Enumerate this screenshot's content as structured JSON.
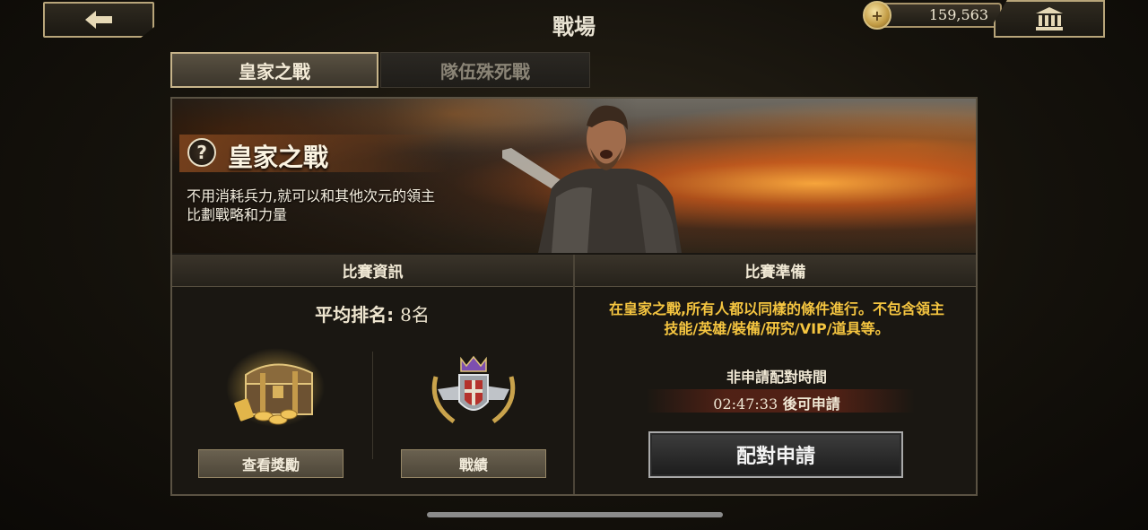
{
  "header": {
    "title": "戰場",
    "coins": "159,563",
    "back_icon": "back-arrow-icon",
    "bank_icon": "bank-icon",
    "coin_plus_icon": "coin-plus-icon"
  },
  "tabs": [
    {
      "label": "皇家之戰",
      "active": true
    },
    {
      "label": "隊伍殊死戰",
      "active": false
    }
  ],
  "banner": {
    "title": "皇家之戰",
    "description_line1": "不用消耗兵力,就可以和其他次元的領主",
    "description_line2": "比劃戰略和力量"
  },
  "info_section": {
    "header": "比賽資訊",
    "avg_rank_label": "平均排名:",
    "avg_rank_value": "8名",
    "rewards_button": "查看獎勵",
    "record_button": "戰績"
  },
  "prep_section": {
    "header": "比賽準備",
    "rules_line1": "在皇家之戰,所有人都以同樣的條件進行。不包含領主",
    "rules_line2": "技能/英雄/裝備/研究/VIP/道具等。",
    "non_apply_label": "非申請配對時間",
    "timer_value": "02:47:33",
    "timer_suffix": "後可申請",
    "match_button": "配對申請"
  },
  "colors": {
    "accent_gold": "#f5c540",
    "frame_gold": "#b8a57a"
  }
}
